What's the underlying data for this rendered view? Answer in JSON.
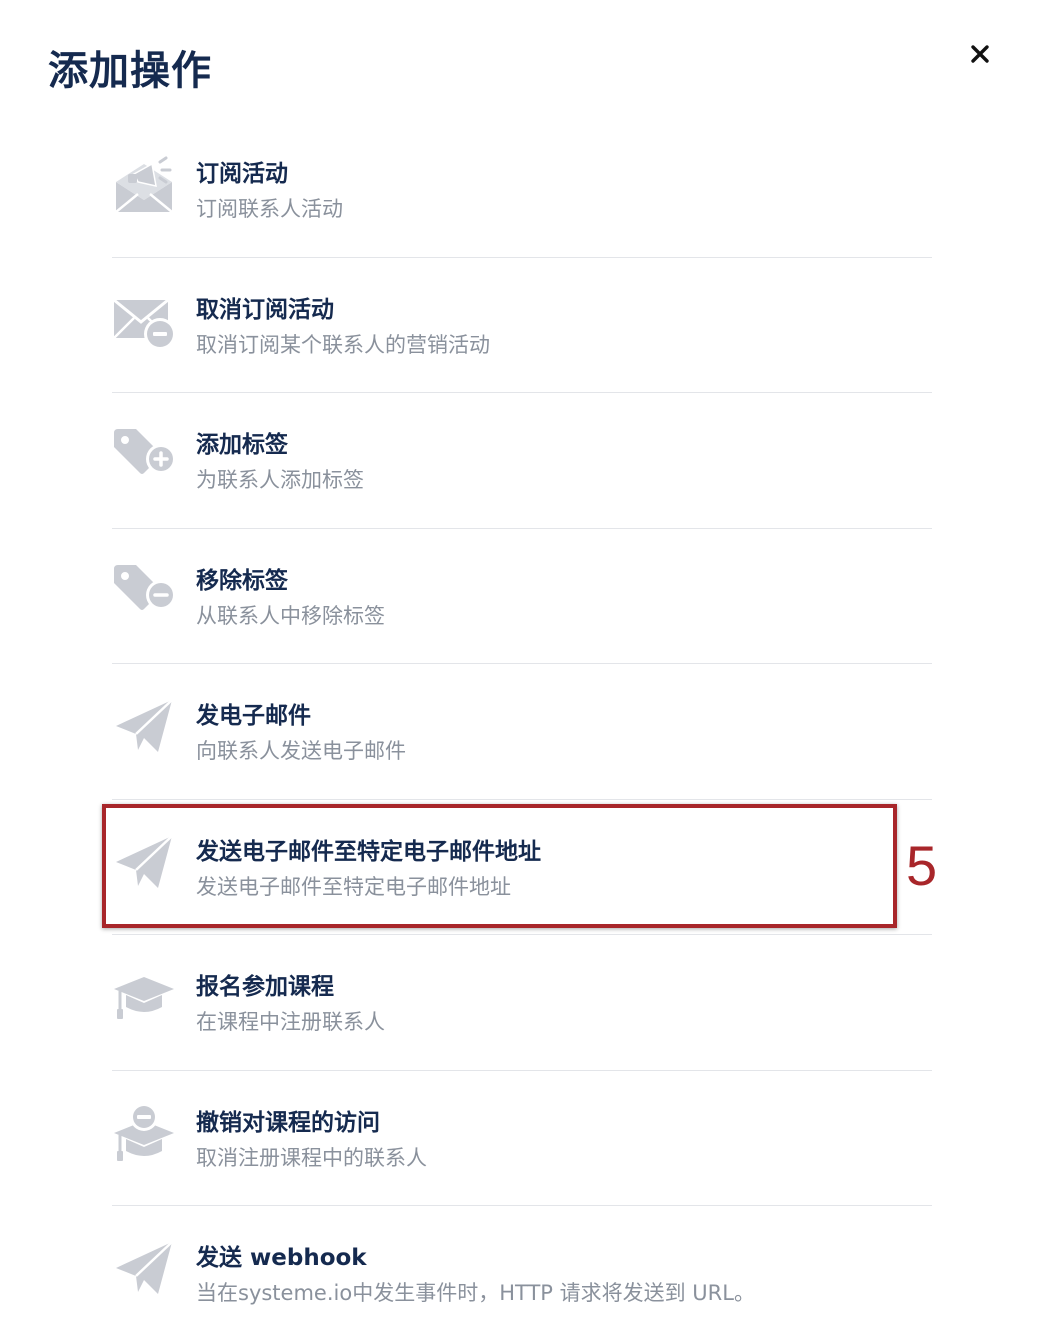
{
  "modal": {
    "title": "添加操作",
    "close_icon": "close-icon"
  },
  "actions": [
    {
      "title": "订阅活动",
      "description": "订阅联系人活动",
      "icon": "campaign-subscribe-icon"
    },
    {
      "title": "取消订阅活动",
      "description": "取消订阅某个联系人的营销活动",
      "icon": "campaign-unsubscribe-icon"
    },
    {
      "title": "添加标签",
      "description": "为联系人添加标签",
      "icon": "tag-add-icon"
    },
    {
      "title": "移除标签",
      "description": "从联系人中移除标签",
      "icon": "tag-remove-icon"
    },
    {
      "title": "发电子邮件",
      "description": "向联系人发送电子邮件",
      "icon": "paper-plane-icon"
    },
    {
      "title": "发送电子邮件至特定电子邮件地址",
      "description": "发送电子邮件至特定电子邮件地址",
      "icon": "paper-plane-icon"
    },
    {
      "title": "报名参加课程",
      "description": "在课程中注册联系人",
      "icon": "graduation-cap-icon"
    },
    {
      "title": "撤销对课程的访问",
      "description": "取消注册课程中的联系人",
      "icon": "graduation-cap-remove-icon"
    },
    {
      "title": "发送 webhook",
      "description": "当在systeme.io中发生事件时，HTTP 请求将发送到 URL。",
      "icon": "paper-plane-icon"
    }
  ],
  "annotation": {
    "step_number": "5",
    "color": "#a8262a"
  },
  "colors": {
    "title": "#152a4f",
    "description": "#8a919c",
    "icon": "#c9ccd3",
    "divider": "#e3e5e9"
  }
}
